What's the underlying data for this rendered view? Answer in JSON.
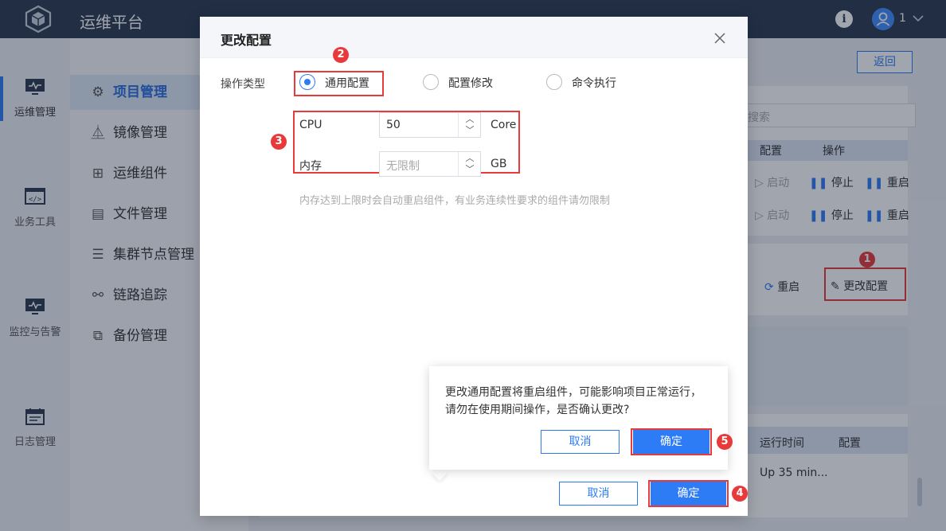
{
  "app": {
    "title": "运维平台",
    "user_name": "1"
  },
  "rail": [
    {
      "label": "运维管理"
    },
    {
      "label": "业务工具"
    },
    {
      "label": "监控与告警"
    },
    {
      "label": "日志管理"
    }
  ],
  "subnav": [
    {
      "label": "项目管理",
      "icon": "gear-icon"
    },
    {
      "label": "镜像管理",
      "icon": "mirror-icon"
    },
    {
      "label": "运维组件",
      "icon": "component-icon"
    },
    {
      "label": "文件管理",
      "icon": "file-icon"
    },
    {
      "label": "集群节点管理",
      "icon": "sliders-icon"
    },
    {
      "label": "链路追踪",
      "icon": "trace-icon"
    },
    {
      "label": "备份管理",
      "icon": "backup-icon"
    }
  ],
  "background": {
    "back_button": "返回",
    "search_placeholder": "搜索",
    "table1_headers": [
      "配置",
      "操作"
    ],
    "row_actions": [
      "启动",
      "停止",
      "重启"
    ],
    "restart_label": "重启",
    "change_config_label": "更改配置",
    "table2_headers": [
      "运行时间",
      "配置"
    ],
    "uptime_value": "Up 35 min..."
  },
  "dialog": {
    "title": "更改配置",
    "operation_label": "操作类型",
    "radios": [
      {
        "label": "通用配置",
        "checked": true
      },
      {
        "label": "配置修改",
        "checked": false
      },
      {
        "label": "命令执行",
        "checked": false
      }
    ],
    "cpu": {
      "label": "CPU",
      "value": "50",
      "unit": "Core"
    },
    "memory": {
      "label": "内存",
      "placeholder": "无限制",
      "unit": "GB"
    },
    "hint": "内存达到上限时会自动重启组件，有业务连续性要求的组件请勿限制",
    "cancel_label": "取消",
    "ok_label": "确定"
  },
  "popconfirm": {
    "message": "更改通用配置将重启组件，可能影响项目正常运行，请勿在使用期间操作，是否确认更改?",
    "cancel_label": "取消",
    "ok_label": "确定"
  },
  "annotations": [
    "1",
    "2",
    "3",
    "4",
    "5"
  ],
  "colors": {
    "primary": "#2d7cf6",
    "topbar": "#2b3a50",
    "annotation": "#e83a3a"
  }
}
